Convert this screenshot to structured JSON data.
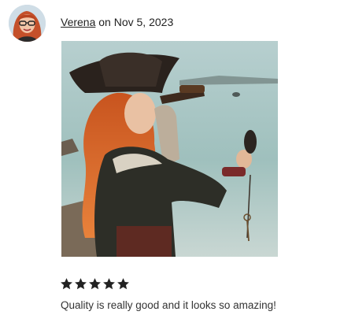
{
  "review": {
    "user": "Verena",
    "date_text": "on Nov 5, 2023",
    "rating": 5,
    "rating_max": 5,
    "text": "Quality is really good and it looks so amazing!"
  },
  "icons": {
    "avatar": "avatar-icon",
    "star": "star-icon"
  },
  "colors": {
    "star": "#222222",
    "text": "#222222"
  }
}
